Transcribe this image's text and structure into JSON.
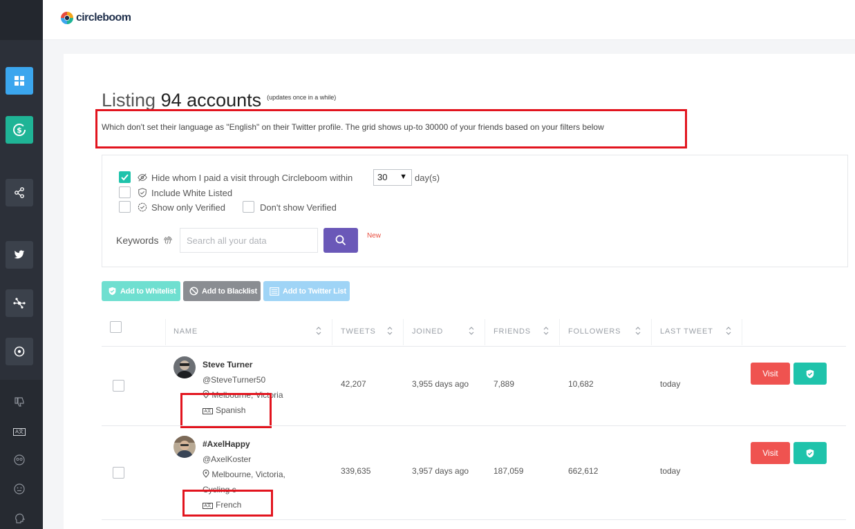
{
  "brand": {
    "name": "circleboom"
  },
  "sidebar": {
    "items": [
      {
        "icon": "dashboard-icon"
      },
      {
        "icon": "dollar-icon"
      },
      {
        "icon": "share-icon"
      },
      {
        "icon": "twitter-icon"
      },
      {
        "icon": "network-icon"
      },
      {
        "icon": "target-icon"
      }
    ],
    "sub_items": [
      {
        "icon": "thumbs-down-icon"
      },
      {
        "icon": "language-icon",
        "text": "A文"
      },
      {
        "icon": "eyes-icon"
      },
      {
        "icon": "face-icon"
      },
      {
        "icon": "head-icon"
      }
    ]
  },
  "page": {
    "title_prefix": "Listing",
    "title_count": "94 accounts",
    "title_note": "(updates once in a while)",
    "subtitle": "Which don't set their language as \"English\" on their Twitter profile. The grid shows up-to 30000 of your friends based on your filters below"
  },
  "filters": {
    "hide_visited_label": "Hide whom I paid a visit through Circleboom within",
    "days_value": "30",
    "days_unit": "day(s)",
    "include_whitelisted_label": "Include White Listed",
    "only_verified_label": "Show only Verified",
    "dont_show_verified_label": "Don't show Verified",
    "keywords_label": "Keywords",
    "search_placeholder": "Search all your data",
    "new_badge": "New"
  },
  "actions": {
    "whitelist": "Add to Whitelist",
    "blacklist": "Add to Blacklist",
    "twitter_list": "Add to Twitter List"
  },
  "table": {
    "columns": [
      "NAME",
      "TWEETS",
      "JOINED",
      "FRIENDS",
      "FOLLOWERS",
      "LAST TWEET"
    ],
    "visit_label": "Visit",
    "rows": [
      {
        "name": "Steve Turner",
        "handle": "@SteveTurner50",
        "location": "Melbourne, Victoria",
        "location_extra": "",
        "language": "Spanish",
        "tweets": "42,207",
        "joined": "3,955 days ago",
        "friends": "7,889",
        "followers": "10,682",
        "last_tweet": "today"
      },
      {
        "name": "#AxelHappy",
        "handle": "@AxelKoster",
        "location": "Melbourne, Victoria,",
        "location_extra": "Cycling c",
        "language": "French",
        "tweets": "339,635",
        "joined": "3,957 days ago",
        "friends": "187,059",
        "followers": "662,612",
        "last_tweet": "today"
      }
    ]
  },
  "colors": {
    "accent_teal": "#1fc3ab",
    "visit_red": "#ef5350",
    "search_purple": "#6a58b8",
    "highlight_red": "#e2141e"
  }
}
